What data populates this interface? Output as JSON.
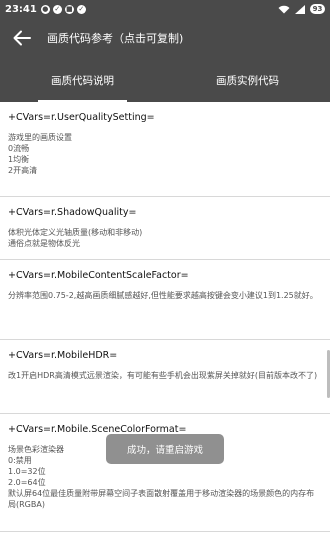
{
  "status_bar": {
    "time": "23:41",
    "notif_icons": [
      "notification-icon",
      "notification-icon",
      "notification-icon",
      "notification-icon"
    ],
    "battery": "93"
  },
  "app_bar": {
    "title": "画质代码参考（点击可复制)"
  },
  "tabs": [
    {
      "label": "画质代码说明",
      "active": true
    },
    {
      "label": "画质实例代码",
      "active": false
    }
  ],
  "sections": [
    {
      "cvar": "+CVars=r.UserQualitySetting=",
      "desc": "游戏里的画质设置\n0流畅\n1均衡\n2开高清"
    },
    {
      "cvar": "+CVars=r.ShadowQuality=",
      "desc": "体积光体定义光轴质量(移动和非移动)\n通俗点就是物体反光"
    },
    {
      "cvar": "+CVars=r.MobileContentScaleFactor=",
      "desc": "分辨率范围0.75-2,越高画质细腻感越好,但性能要求越高按键会变小建议1到1.25就好。"
    },
    {
      "cvar": "+CVars=r.MobileHDR=",
      "desc": "改1开启HDR高清模式远景渲染，有可能有些手机会出现紫屏关掉就好(目前版本改不了)"
    },
    {
      "cvar": "+CVars=r.Mobile.SceneColorFormat=",
      "desc": "场景色彩渲染器\n0:禁用\n1.0=32位\n2.0=64位\n默认屏64位最佳质量附带屏幕空间子表面散射覆盖用于移动渲染器的场景颜色的内存布局(RGBA)"
    }
  ],
  "toast": {
    "text": "成功，请重启游戏"
  }
}
